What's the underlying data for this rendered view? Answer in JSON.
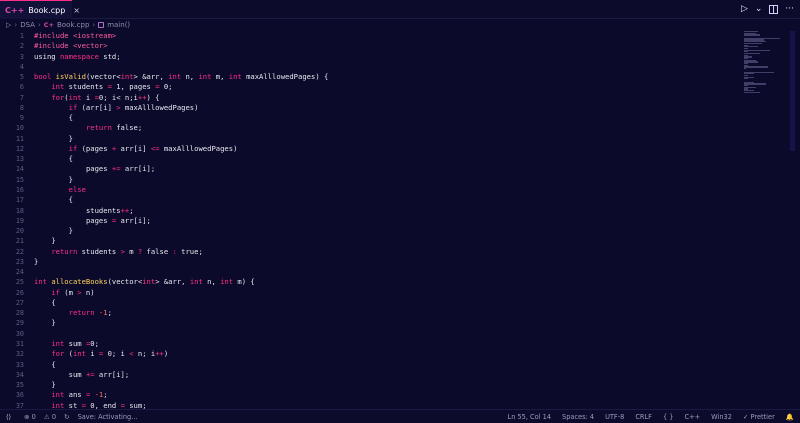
{
  "tab": {
    "icon_text": "C++",
    "label": "Book.cpp",
    "close": "×"
  },
  "tab_actions": {
    "run": "▷",
    "run_menu": "⌄",
    "more": "···"
  },
  "breadcrumb": {
    "folder": "DSA",
    "file": "Book.cpp",
    "symbol": "main()"
  },
  "colors": {
    "background": "#0b0a2a",
    "keyword": "#ff2e88",
    "function": "#ffd45c",
    "accent": "#ff2e88"
  },
  "line_numbers": [
    "1",
    "2",
    "3",
    "4",
    "5",
    "6",
    "7",
    "8",
    "9",
    "10",
    "11",
    "12",
    "13",
    "14",
    "15",
    "16",
    "17",
    "18",
    "19",
    "20",
    "21",
    "22",
    "23",
    "24",
    "25",
    "26",
    "27",
    "28",
    "29",
    "30",
    "31",
    "32",
    "33",
    "34",
    "35",
    "36",
    "37"
  ],
  "code": {
    "l1": "#include <iostream>",
    "l2": "#include <vector>",
    "l3a": "using ",
    "l3b": "namespace",
    "l3c": " std;",
    "l5a": "bool ",
    "l5b": "isValid",
    "l5c": "(vector<",
    "l5d": "int",
    "l5e": "> &arr, ",
    "l5f": "int",
    "l5g": " n, ",
    "l5h": "int",
    "l5i": " m, ",
    "l5j": "int",
    "l5k": " maxAlllowedPages) {",
    "l6a": "int",
    "l6b": " students ",
    "l6c": "=",
    "l6d": " 1, pages ",
    "l6e": "=",
    "l6f": " 0;",
    "l7a": "for",
    "l7b": "(",
    "l7c": "int",
    "l7d": " i ",
    "l7e": "=",
    "l7f": "0; i< n;i",
    "l7g": "++",
    "l7h": ") {",
    "l8a": "if",
    "l8b": " (arr[i] ",
    "l8c": ">",
    "l8d": " maxAlllowedPages)",
    "l9": "{",
    "l10a": "return",
    "l10b": " false;",
    "l11": "}",
    "l12a": "if",
    "l12b": " (pages ",
    "l12c": "+",
    "l12d": " arr[i] ",
    "l12e": "<=",
    "l12f": " maxAlllowedPages)",
    "l13": "{",
    "l14a": "pages ",
    "l14b": "+=",
    "l14c": " arr[i];",
    "l15": "}",
    "l16": "else",
    "l17": "{",
    "l18a": "students",
    "l18b": "++",
    "l18c": ";",
    "l19a": "pages ",
    "l19b": "=",
    "l19c": " arr[i];",
    "l20": "}",
    "l21": "}",
    "l22a": "return",
    "l22b": " students ",
    "l22c": ">",
    "l22d": " m ",
    "l22e": "?",
    "l22f": " false ",
    "l22g": ":",
    "l22h": " true;",
    "l23": "}",
    "l25a": "int",
    "l25b": " ",
    "l25c": "allocateBooks",
    "l25d": "(vector<",
    "l25e": "int",
    "l25f": "> &arr, ",
    "l25g": "int",
    "l25h": " n, ",
    "l25i": "int",
    "l25j": " m) {",
    "l26a": "if",
    "l26b": " (m ",
    "l26c": ">",
    "l26d": " n)",
    "l27": "{",
    "l28a": "return",
    "l28b": " ",
    "l28c": "-1",
    "l28d": ";",
    "l29": "}",
    "l31a": "int",
    "l31b": " sum ",
    "l31c": "=",
    "l31d": "0;",
    "l32a": "for",
    "l32b": " (",
    "l32c": "int",
    "l32d": " i ",
    "l32e": "=",
    "l32f": " 0; i ",
    "l32g": "<",
    "l32h": " n; i",
    "l32i": "++",
    "l32j": ")",
    "l33": "{",
    "l34a": "sum ",
    "l34b": "+=",
    "l34c": " arr[i];",
    "l35": "}",
    "l36a": "int",
    "l36b": " ans ",
    "l36c": "=",
    "l36d": " ",
    "l36e": "-1",
    "l36f": ";",
    "l37a": "int",
    "l37b": " st ",
    "l37c": "=",
    "l37d": " 0, end ",
    "l37e": "=",
    "l37f": " sum;"
  },
  "statusbar": {
    "remote": "⟨⟩",
    "errors": "⊗ 0",
    "warnings": "⚠ 0",
    "refresh": "↻",
    "save_status": "Save: Activating...",
    "position": "Ln 55, Col 14",
    "spaces": "Spaces: 4",
    "encoding": "UTF-8",
    "eol": "CRLF",
    "braces": "{ }",
    "language": "C++",
    "platform": "Win32",
    "formatter": "✓ Prettier",
    "bell": "🔔"
  }
}
